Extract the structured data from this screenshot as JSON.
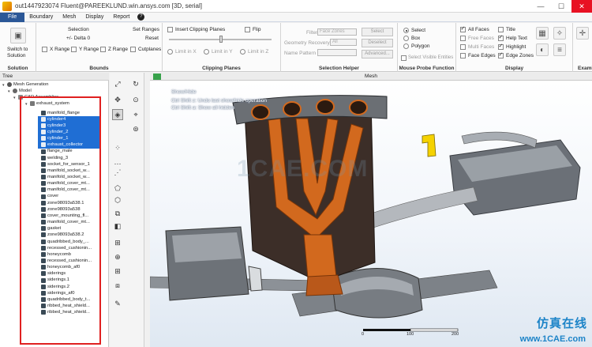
{
  "window": {
    "title": "out1447923074 Fluent@PAREEKLUND.win.ansys.com  [3D, serial]"
  },
  "menu": {
    "items": [
      "File",
      "Boundary",
      "Mesh",
      "Display",
      "Report"
    ],
    "help": "?"
  },
  "ribbon": {
    "bounds": {
      "switch_label_1": "Switch to",
      "switch_label_2": "Solution",
      "selection": "Selection",
      "delta": "+/- Delta 0",
      "set_ranges": "Set Ranges",
      "reset": "Reset",
      "x_range": "X Range",
      "y_range": "Y Range",
      "z_range": "Z Range",
      "cutplanes": "Cutplanes",
      "title": "Bounds",
      "solution": "Solution"
    },
    "clipping": {
      "insert": "Insert Clipping Planes",
      "flip": "Flip",
      "limit_x": "Limit in X",
      "limit_y": "Limit in Y",
      "limit_z": "Limit in Z",
      "title": "Clipping Planes"
    },
    "selection_helper": {
      "filter_label": "Filter",
      "filter_value": "Face Zones",
      "geometry_label": "Geometry Recovery",
      "geometry_value": "All",
      "name_label": "Name Pattern",
      "select": "Select",
      "deselect": "Deselect",
      "advanced": "Advanced...",
      "title": "Selection Helper"
    },
    "probe": {
      "select": "Select",
      "box": "Box",
      "polygon": "Polygon",
      "visible": "Select Visible Entities",
      "title": "Mouse Probe Function"
    },
    "display": {
      "all_faces": "All Faces",
      "free_faces": "Free Faces",
      "multi_faces": "Multi Faces",
      "face_edges": "Face Edges",
      "title_opt": "Title",
      "help_text": "Help Text",
      "highlight": "Highlight",
      "edge_zones": "Edge Zones",
      "title": "Display",
      "examine": "Examin"
    }
  },
  "tree": {
    "header": "Tree",
    "root": "Mesh Generation",
    "model": "Model",
    "cad": "CAD Assemblies",
    "exhaust": "exhaust_system",
    "items": [
      "manifold_flange",
      "cylinder4",
      "cylinder3",
      "cylinder_2",
      "cylinder_1",
      "exhaust_collector",
      "flange_male",
      "welding_3",
      "socket_for_sensor_1",
      "manifold_socket_w...",
      "manifold_socket_w...",
      "manifold_cover_mt...",
      "manifold_cover_mt...",
      "cover",
      "zone98093a538.1",
      "zone98093a538",
      "cover_mounting_fl...",
      "manifold_cover_mt...",
      "gasket",
      "zone98093a538.2",
      "quadribbed_body_...",
      "recessed_cushionin...",
      "honeycomb",
      "recessed_cushionin...",
      "honeycomb_af0",
      "siderings",
      "siderings.1",
      "siderings.2",
      "siderings_af0",
      "quadribbed_body_t...",
      "ribbed_heat_shield...",
      "ribbed_heat_shield..."
    ],
    "selected": [
      1,
      2,
      3,
      4,
      5
    ]
  },
  "viewport": {
    "tab": "Mesh",
    "messages": [
      "Show/Hide",
      "Ctrl Shift z: Undo last show/hide operation",
      "Ctrl Shift a: Show all hidden"
    ],
    "watermark": "1CAE.COM",
    "scale": [
      "0",
      "100",
      "200"
    ],
    "brand_cn": "仿真在线",
    "brand_url": "www.1CAE.com"
  },
  "colors": {
    "accent": "#1f6ed4",
    "highlight_box": "#e02020",
    "pipe_orange": "#d2691e",
    "brand": "#1d84c8"
  }
}
